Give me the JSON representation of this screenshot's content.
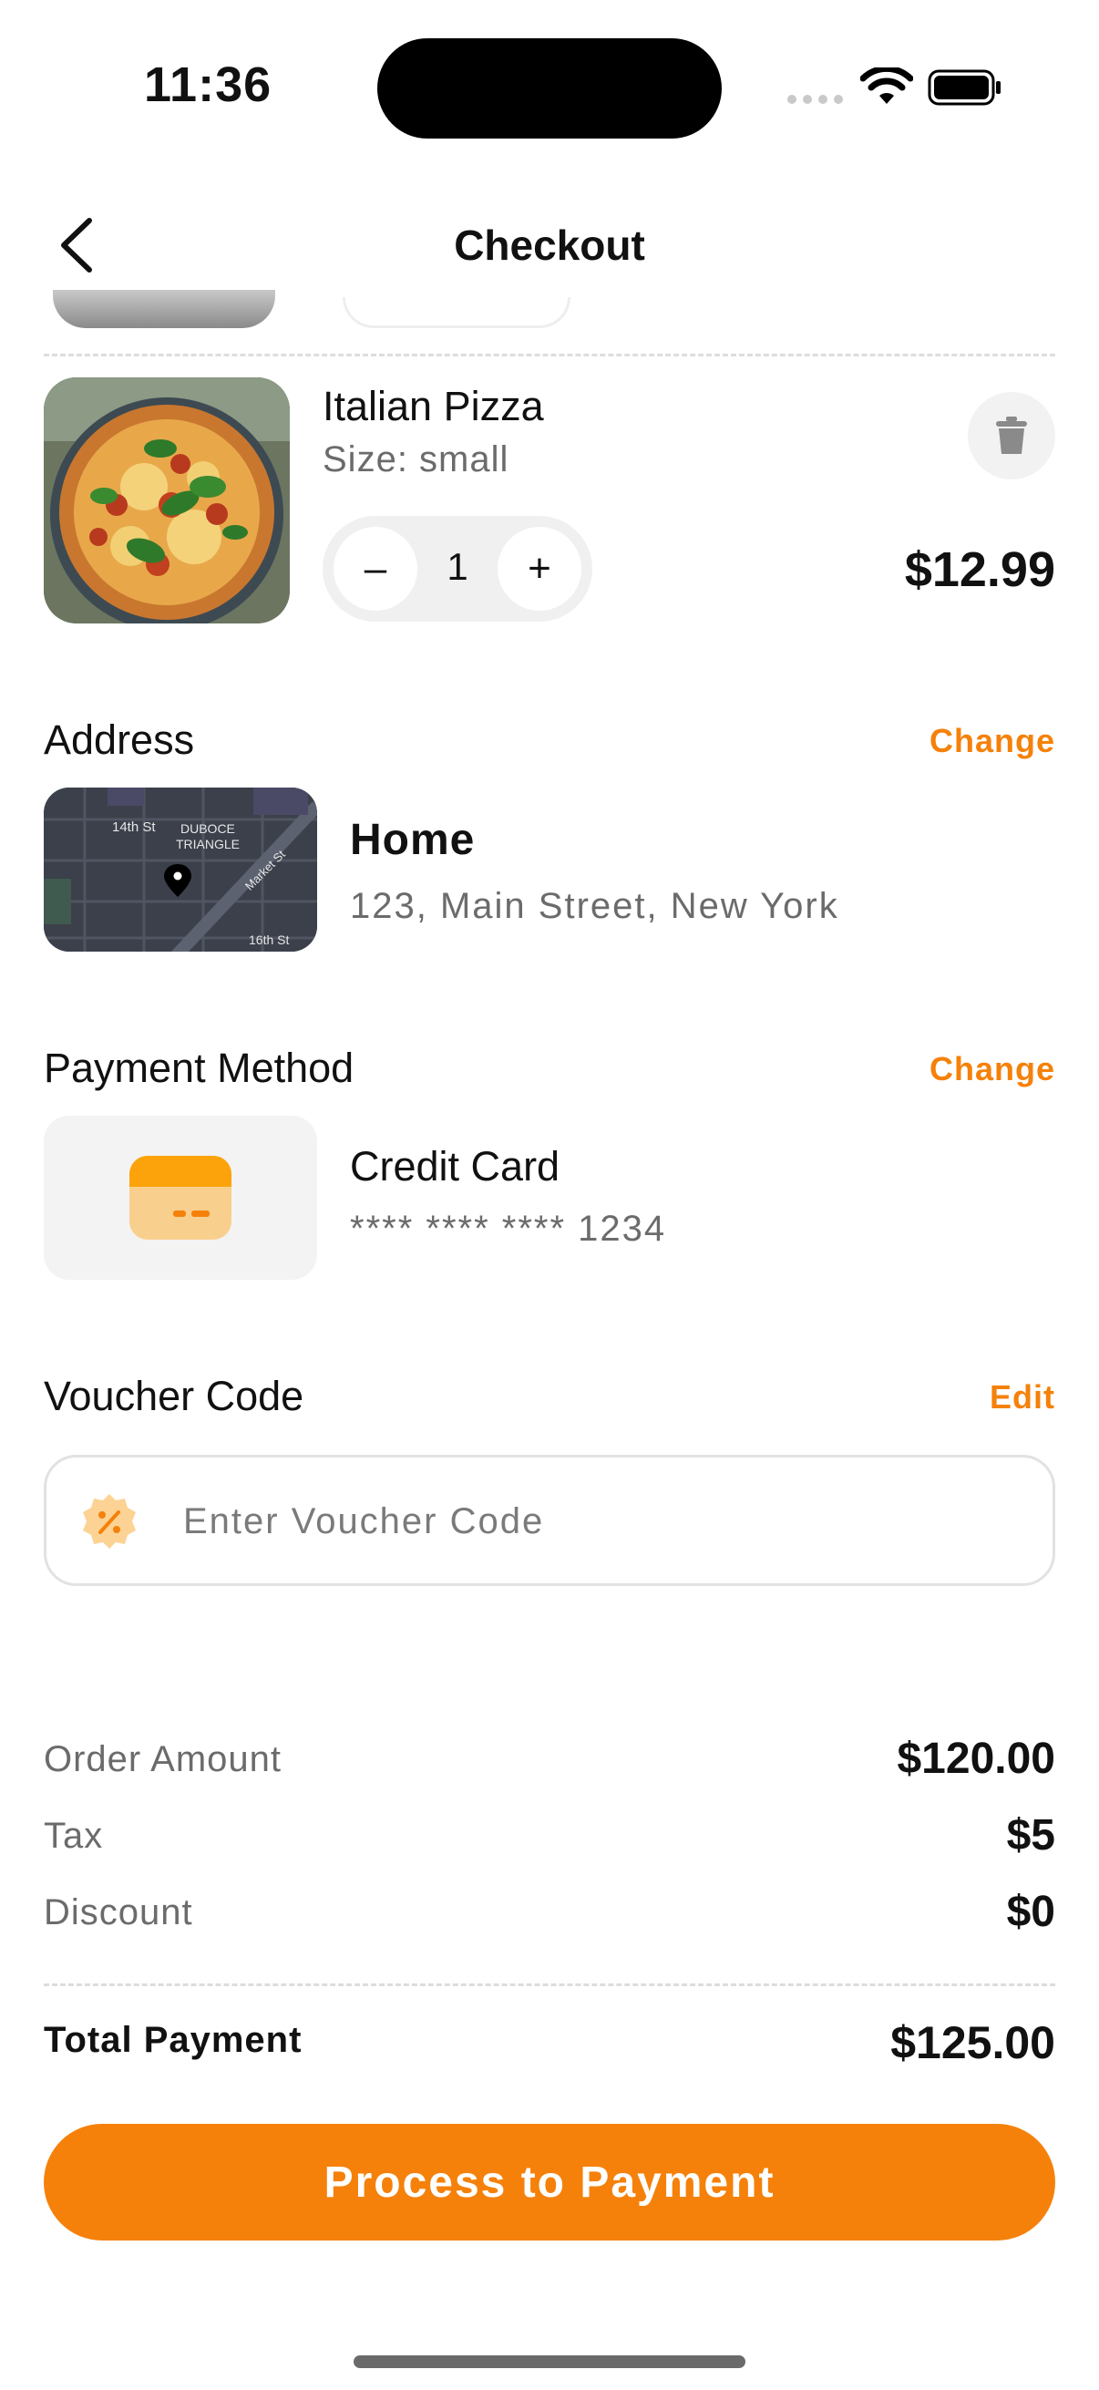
{
  "status_bar": {
    "time": "11:36"
  },
  "header": {
    "title": "Checkout"
  },
  "cart_item": {
    "name": "Italian Pizza",
    "size": "Size: small",
    "quantity": "1",
    "price": "$12.99",
    "decrement_symbol": "–",
    "increment_symbol": "+"
  },
  "address": {
    "section_label": "Address",
    "action": "Change",
    "name": "Home",
    "line": "123, Main Street, New York",
    "map_labels": {
      "street1": "14th St",
      "district_line1": "DUBOCE",
      "district_line2": "TRIANGLE",
      "street2": "Market St",
      "street3": "16th St"
    }
  },
  "payment": {
    "section_label": "Payment Method",
    "action": "Change",
    "method": "Credit Card",
    "card_number": "**** **** **** 1234"
  },
  "voucher": {
    "section_label": "Voucher Code",
    "action": "Edit",
    "placeholder": "Enter Voucher Code",
    "value": ""
  },
  "summary": {
    "rows": [
      {
        "label": "Order Amount",
        "value": "$120.00"
      },
      {
        "label": "Tax",
        "value": "$5"
      },
      {
        "label": "Discount",
        "value": "$0"
      }
    ],
    "total_label": "Total Payment",
    "total_value": "$125.00"
  },
  "cta": {
    "label": "Process to Payment"
  },
  "colors": {
    "accent": "#f5810a",
    "muted_text": "#6b6b6b",
    "card_icon_light": "#f9cf8e"
  },
  "icons": [
    "back-arrow-icon",
    "trash-icon",
    "map-pin-icon",
    "credit-card-icon",
    "discount-badge-icon",
    "wifi-icon",
    "battery-icon"
  ]
}
